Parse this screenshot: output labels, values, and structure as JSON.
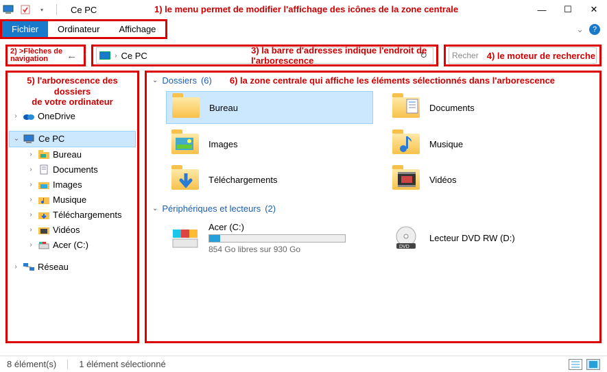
{
  "title": "Ce PC",
  "annotations": {
    "a1": "1) le menu permet de modifier l'affichage des icônes de la zone centrale",
    "a2a": "2) >Flèches de",
    "a2b": "navigation",
    "a3": "3) la barre d'adresses indique l'endroit de l'arborescence",
    "a4": "4) le moteur de recherche",
    "a5a": "5) l'arborescence des",
    "a5b": "dossiers",
    "a5c": "de votre ordinateur",
    "a6": "6) la zone centrale qui affiche les éléments sélectionnés dans l'arborescence"
  },
  "menu": {
    "file": "Fichier",
    "computer": "Ordinateur",
    "view": "Affichage"
  },
  "address": {
    "location": "Ce PC"
  },
  "search": {
    "placeholder": "Recher"
  },
  "sidebar": {
    "onedrive": "OneDrive",
    "cepc": "Ce PC",
    "items": [
      "Bureau",
      "Documents",
      "Images",
      "Musique",
      "Téléchargements",
      "Vidéos",
      "Acer (C:)"
    ],
    "network": "Réseau"
  },
  "groups": {
    "folders": {
      "label": "Dossiers",
      "count": "(6)"
    },
    "devices": {
      "label": "Périphériques et lecteurs",
      "count": "(2)"
    }
  },
  "folders": [
    {
      "name": "Bureau",
      "icon": "folder"
    },
    {
      "name": "Documents",
      "icon": "documents"
    },
    {
      "name": "Images",
      "icon": "images"
    },
    {
      "name": "Musique",
      "icon": "music"
    },
    {
      "name": "Téléchargements",
      "icon": "downloads"
    },
    {
      "name": "Vidéos",
      "icon": "videos"
    }
  ],
  "drives": [
    {
      "name": "Acer (C:)",
      "free": "854 Go libres sur 930 Go"
    },
    {
      "name": "Lecteur DVD RW (D:)"
    }
  ],
  "status": {
    "count": "8 élément(s)",
    "selected": "1 élément sélectionné"
  }
}
